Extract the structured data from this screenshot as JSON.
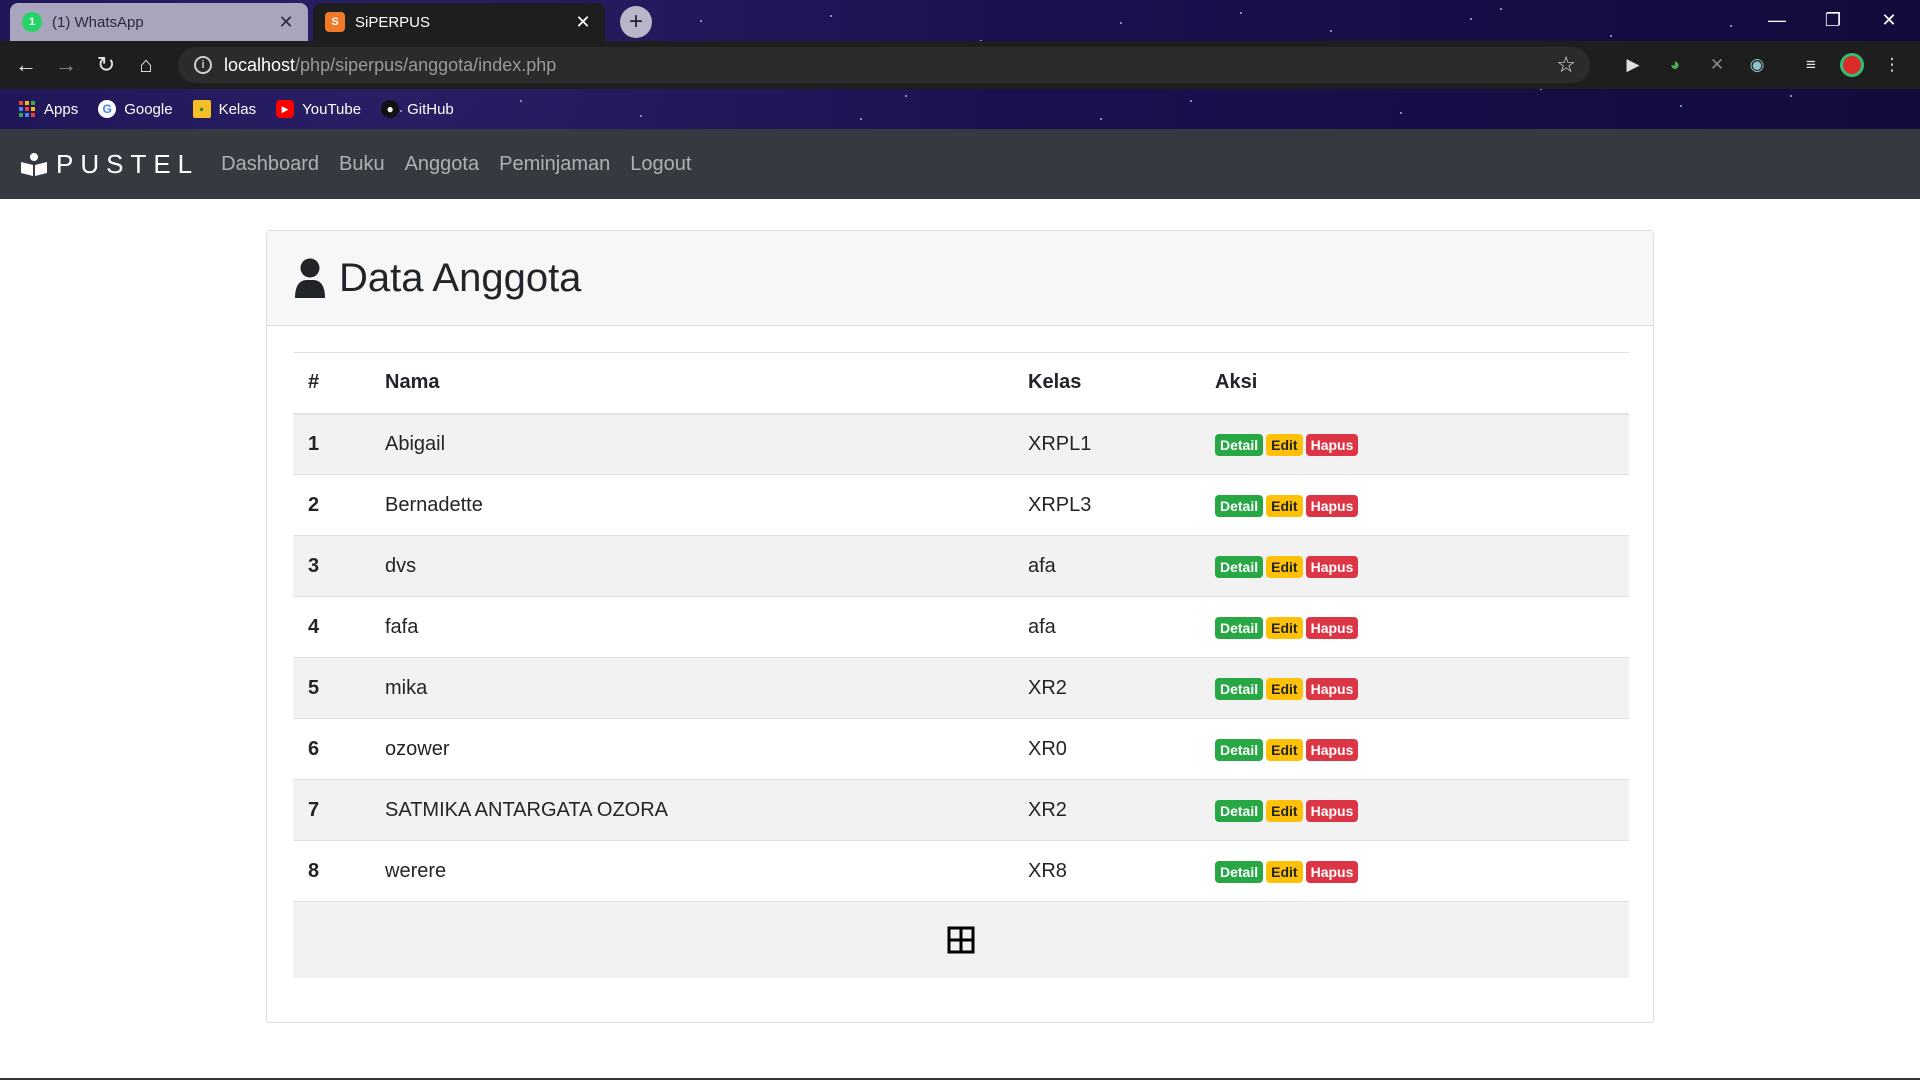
{
  "browser": {
    "tabs": [
      {
        "title": "(1) WhatsApp",
        "favicon": "whatsapp-icon",
        "active": false
      },
      {
        "title": "SiPERPUS",
        "favicon": "siperpus-icon",
        "active": true
      }
    ],
    "address": {
      "host": "localhost",
      "path": "/php/siperpus/anggota/index.php"
    },
    "bookmarks": [
      {
        "label": "Apps",
        "icon": "apps-grid-icon"
      },
      {
        "label": "Google",
        "icon": "google-icon"
      },
      {
        "label": "Kelas",
        "icon": "classroom-icon"
      },
      {
        "label": "YouTube",
        "icon": "youtube-icon"
      },
      {
        "label": "GitHub",
        "icon": "github-icon"
      }
    ]
  },
  "navbar": {
    "brand": "PUSTEL",
    "links": [
      "Dashboard",
      "Buku",
      "Anggota",
      "Peminjaman",
      "Logout"
    ]
  },
  "page": {
    "title": "Data Anggota",
    "table": {
      "headers": [
        "#",
        "Nama",
        "Kelas",
        "Aksi"
      ],
      "actions": {
        "detail": "Detail",
        "edit": "Edit",
        "hapus": "Hapus"
      },
      "rows": [
        {
          "no": "1",
          "nama": "Abigail",
          "kelas": "XRPL1"
        },
        {
          "no": "2",
          "nama": "Bernadette",
          "kelas": "XRPL3"
        },
        {
          "no": "3",
          "nama": "dvs",
          "kelas": "afa"
        },
        {
          "no": "4",
          "nama": "fafa",
          "kelas": "afa"
        },
        {
          "no": "5",
          "nama": "mika",
          "kelas": "XR2"
        },
        {
          "no": "6",
          "nama": "ozower",
          "kelas": "XR0"
        },
        {
          "no": "7",
          "nama": "SATMIKA ANTARGATA OZORA",
          "kelas": "XR2"
        },
        {
          "no": "8",
          "nama": "werere",
          "kelas": "XR8"
        }
      ]
    }
  },
  "colors": {
    "navbar": "#343a40",
    "detail": "#28a745",
    "edit": "#ffc107",
    "hapus": "#dc3545"
  }
}
